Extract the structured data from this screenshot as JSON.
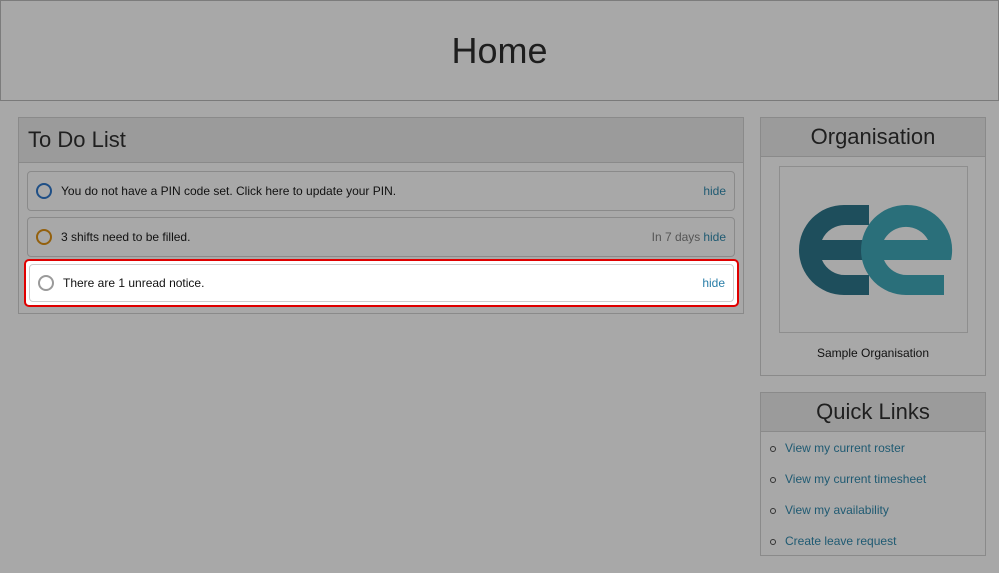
{
  "header": {
    "title": "Home"
  },
  "todo": {
    "title": "To Do List",
    "items": [
      {
        "text": "You do not have a PIN code set. Click here to update your PIN.",
        "meta": "",
        "action": "hide",
        "status_color": "#1f4f86"
      },
      {
        "text": "3 shifts need to be filled.",
        "meta": "In 7 days",
        "action": "hide",
        "status_color": "#93600d"
      },
      {
        "text": "There are 1 unread notice.",
        "meta": "",
        "action": "hide",
        "status_color": "#9a9a9a"
      }
    ]
  },
  "organisation": {
    "title": "Organisation",
    "name": "Sample Organisation",
    "logo_icon": "ee-logo-icon",
    "logo_colors": [
      "#1e4e5c",
      "#2a6f7a"
    ]
  },
  "quick_links": {
    "title": "Quick Links",
    "items": [
      {
        "label": "View my current roster"
      },
      {
        "label": "View my current timesheet"
      },
      {
        "label": "View my availability"
      },
      {
        "label": "Create leave request"
      }
    ]
  }
}
